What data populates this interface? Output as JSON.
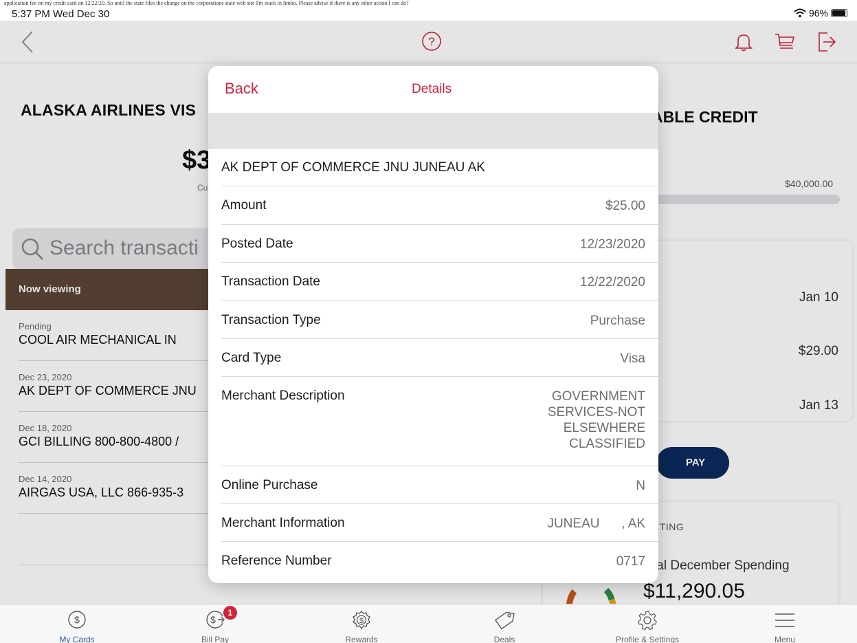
{
  "caption": "application fee on my credit card on 12/22/20. So until the state files the change on the corporations state web site I'm stuck in limbo. Please advise if there is any other action I can do?",
  "status": {
    "time": "5:37 PM  Wed Dec 30",
    "battery": "96%"
  },
  "left": {
    "card_title": "ALASKA AIRLINES VIS",
    "balance": "$3",
    "balance_sub": "Cu",
    "search_placeholder": "Search transacti",
    "now_viewing": "Now viewing",
    "transactions": [
      {
        "date": "Pending",
        "name": "COOL AIR MECHANICAL IN"
      },
      {
        "date": "Dec 23, 2020",
        "name": "AK DEPT OF COMMERCE JNU"
      },
      {
        "date": "Dec 18, 2020",
        "name": "GCI BILLING 800-800-4800 /"
      },
      {
        "date": "Dec 14, 2020",
        "name": "AIRGAS USA, LLC 866-935-3"
      }
    ]
  },
  "right": {
    "available_title": "ABLE CREDIT",
    "credit_limit": "$40,000.00",
    "info_values": [
      "Jan 10",
      "$29.00",
      "Jan 13"
    ],
    "pay_label": "PAY",
    "budget_label": "ETING",
    "budget_sub": "tal December Spending",
    "budget_total": "$11,290.05"
  },
  "modal": {
    "back_label": "Back",
    "title": "Details",
    "merchant": "AK DEPT OF COMMERCE JNU JUNEAU AK",
    "rows": [
      {
        "label": "Amount",
        "value": "$25.00"
      },
      {
        "label": "Posted Date",
        "value": "12/23/2020"
      },
      {
        "label": "Transaction Date",
        "value": "12/22/2020"
      },
      {
        "label": "Transaction Type",
        "value": "Purchase"
      },
      {
        "label": "Card Type",
        "value": "Visa"
      },
      {
        "label": "Merchant Description",
        "value": "GOVERNMENT\nSERVICES-NOT\nELSEWHERE\nCLASSIFIED"
      },
      {
        "label": "Online Purchase",
        "value": "N"
      },
      {
        "label": "Merchant Information",
        "value": "JUNEAU      , AK"
      },
      {
        "label": "Reference Number",
        "value": "0717"
      }
    ]
  },
  "tabs": [
    {
      "label": "My Cards",
      "icon": "dollar-circle-icon",
      "active": true
    },
    {
      "label": "Bill Pay",
      "icon": "bill-pay-icon",
      "badge": "1"
    },
    {
      "label": "Rewards",
      "icon": "rewards-badge-icon"
    },
    {
      "label": "Deals",
      "icon": "tag-icon"
    },
    {
      "label": "Profile & Settings",
      "icon": "gear-icon"
    },
    {
      "label": "Menu",
      "icon": "hamburger-menu-icon"
    }
  ],
  "colors": {
    "accent": "#d2233c",
    "navy": "#0d2b5e",
    "now_viewing_bg": "#5b4636",
    "active_tab": "#2e5d9c"
  }
}
